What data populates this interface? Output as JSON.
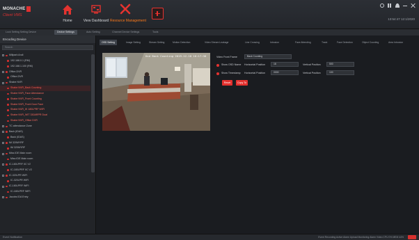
{
  "brand": {
    "line1": "MONACHE",
    "line2": "Client VMS"
  },
  "nav": {
    "home": "Home",
    "dashboard": "View Dashboard",
    "resource": "Resource Management"
  },
  "clock": "13:54:47 12:1/2020",
  "tabs": [
    "Lock Setting Setting Device",
    "Device Settings",
    "Auto Setting",
    "Channel Device Settings",
    "Tools"
  ],
  "sidebar": {
    "title": "Encoding Device",
    "search_placeholder": "Search",
    "tree": [
      {
        "label": "Millpark Andi",
        "level": 0,
        "kind": "box"
      },
      {
        "label": "192.168.0.1 (RM)",
        "level": 1,
        "kind": "dot"
      },
      {
        "label": "192.168.1.100 (RM)",
        "level": 1,
        "kind": "dot"
      },
      {
        "label": "Office-DVR",
        "level": 0,
        "kind": "box"
      },
      {
        "label": "Office-DVR",
        "level": 1,
        "kind": "dot"
      },
      {
        "label": "Shabe NVR",
        "level": 0,
        "kind": "box"
      },
      {
        "label": "Shabe NVR_Back Counting",
        "level": 1,
        "kind": "dot",
        "state": "sel"
      },
      {
        "label": "Shabe NVR_Face Attendance",
        "level": 1,
        "kind": "dot",
        "state": "hl"
      },
      {
        "label": "Shabe NVR_Front Counting",
        "level": 1,
        "kind": "dot",
        "state": "hl"
      },
      {
        "label": "Shabe NVR_Front Door Face",
        "level": 1,
        "kind": "dot",
        "state": "hl"
      },
      {
        "label": "Shabe NVR_IK 180LPRF WIFI",
        "level": 1,
        "kind": "dot",
        "state": "hl"
      },
      {
        "label": "Shabe NVR_WIT 330ARPR Dual",
        "level": 1,
        "kind": "dot",
        "state": "hl"
      },
      {
        "label": "Shabe NVR_Office DVR",
        "level": 1,
        "kind": "dot",
        "state": "hl"
      },
      {
        "label": "TC attendance Zone",
        "level": 0,
        "kind": "box"
      },
      {
        "label": "Back (IDAS)",
        "level": 0,
        "kind": "box"
      },
      {
        "label": "Back (IDAS)",
        "level": 1,
        "kind": "dot"
      },
      {
        "label": "IM 320MYRF",
        "level": 0,
        "kind": "box"
      },
      {
        "label": "IM 320MYRF",
        "level": 1,
        "kind": "dot"
      },
      {
        "label": "Miss IDE Main room",
        "level": 0,
        "kind": "box"
      },
      {
        "label": "Miss IDE Main room",
        "level": 1,
        "kind": "dot"
      },
      {
        "label": "IC-180LPRF IIC V2",
        "level": 0,
        "kind": "box"
      },
      {
        "label": "IC-180LPRF IIC V2",
        "level": 1,
        "kind": "dot"
      },
      {
        "label": "IC-320LPR WIFI",
        "level": 0,
        "kind": "box"
      },
      {
        "label": "IC-320LPR WIFI",
        "level": 1,
        "kind": "dot"
      },
      {
        "label": "IC-180LPRF WIFI",
        "level": 0,
        "kind": "box"
      },
      {
        "label": "IC-180LPRF WIFI",
        "level": 1,
        "kind": "dot"
      },
      {
        "label": "Jacobs IDA Entry",
        "level": 0,
        "kind": "box"
      }
    ]
  },
  "subtabs": [
    "OSD Setting",
    "Image Setting",
    "Stream Setting",
    "Motion Detection",
    "Video Stream Leakage",
    "Line Crossing",
    "Intrusion",
    "Face Attending",
    "Track",
    "Face Detection",
    "Object Counting",
    "Area Intrusion"
  ],
  "osd_text": "Osd Back Counting  2019-12-18 10:17:30",
  "form": {
    "front_frame_label": "Video Front Frame",
    "front_frame_value": "Back Counting",
    "show_osd_label": "Show OSD Name",
    "show_time_label": "Show Timestamp",
    "hpos_label": "Horizontal Position",
    "vpos_label": "Vertical Position",
    "osd_h": "18",
    "osd_v": "500",
    "ts_h": "0000",
    "ts_v": "100",
    "reset_label": "Reset",
    "copy_label": "Copy To"
  },
  "status": {
    "left": "Event Notification",
    "right": "Event Recording   Active Alarm   Upload Monitoring   Alarm Video   CPU 0%   MEM 44%"
  }
}
